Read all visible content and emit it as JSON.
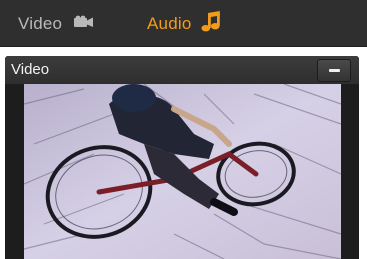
{
  "tabs": [
    {
      "label": "Video",
      "icon": "video-camera-icon",
      "active": false
    },
    {
      "label": "Audio",
      "icon": "music-note-icon",
      "active": true
    }
  ],
  "panel": {
    "title": "Video",
    "collapse_button": "minus-icon"
  },
  "colors": {
    "tab_bar_bg": "#2f2f2f",
    "active_tab": "#f39c1a",
    "inactive_tab": "#b9b9b9",
    "panel_bg": "#2b2b2b"
  }
}
